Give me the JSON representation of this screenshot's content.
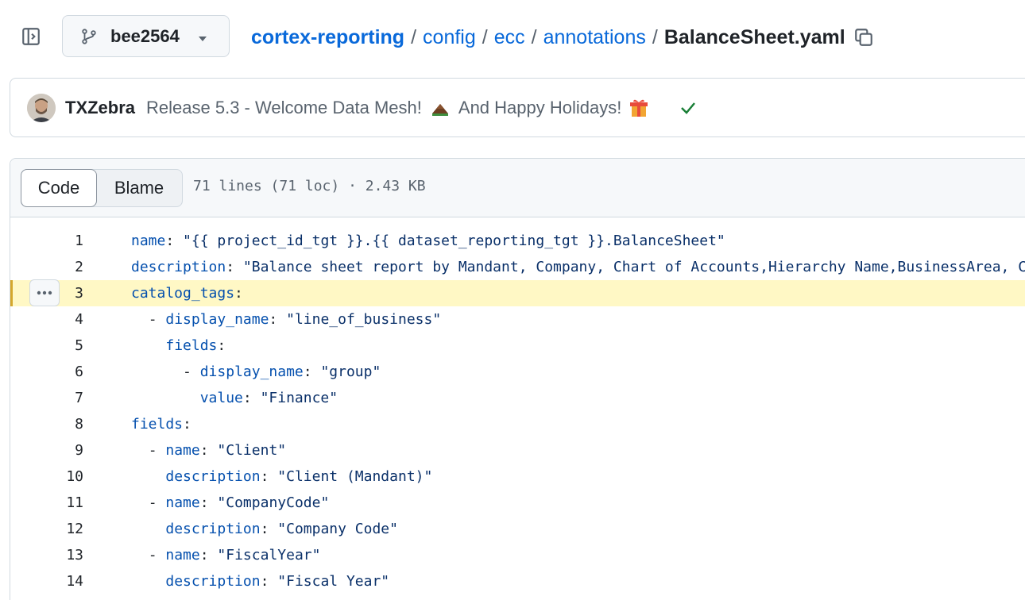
{
  "header": {
    "branch": "bee2564",
    "breadcrumb": {
      "repo": "cortex-reporting",
      "dirs": [
        "config",
        "ecc",
        "annotations"
      ],
      "file": "BalanceSheet.yaml",
      "separator": "/"
    }
  },
  "commit": {
    "author": "TXZebra",
    "message_part1": "Release 5.3 - Welcome Data Mesh!",
    "message_part2": "And Happy Holidays!",
    "status": "success"
  },
  "file": {
    "tabs": {
      "code": "Code",
      "blame": "Blame"
    },
    "meta": "71 lines (71 loc) · 2.43 KB",
    "highlighted_line": 3,
    "lines": [
      {
        "n": "1",
        "indent": "",
        "dash": "",
        "key": "name",
        "colon": ": ",
        "value": "\"{{ project_id_tgt }}.{{ dataset_reporting_tgt }}.BalanceSheet\""
      },
      {
        "n": "2",
        "indent": "",
        "dash": "",
        "key": "description",
        "colon": ": ",
        "value": "\"Balance sheet report by Mandant, Company, Chart of Accounts,Hierarchy Name,BusinessArea, C"
      },
      {
        "n": "3",
        "indent": "",
        "dash": "",
        "key": "catalog_tags",
        "colon": ":",
        "value": ""
      },
      {
        "n": "4",
        "indent": "  ",
        "dash": "- ",
        "key": "display_name",
        "colon": ": ",
        "value": "\"line_of_business\""
      },
      {
        "n": "5",
        "indent": "    ",
        "dash": "",
        "key": "fields",
        "colon": ":",
        "value": ""
      },
      {
        "n": "6",
        "indent": "      ",
        "dash": "- ",
        "key": "display_name",
        "colon": ": ",
        "value": "\"group\""
      },
      {
        "n": "7",
        "indent": "        ",
        "dash": "",
        "key": "value",
        "colon": ": ",
        "value": "\"Finance\""
      },
      {
        "n": "8",
        "indent": "",
        "dash": "",
        "key": "fields",
        "colon": ":",
        "value": ""
      },
      {
        "n": "9",
        "indent": "  ",
        "dash": "- ",
        "key": "name",
        "colon": ": ",
        "value": "\"Client\""
      },
      {
        "n": "10",
        "indent": "    ",
        "dash": "",
        "key": "description",
        "colon": ": ",
        "value": "\"Client (Mandant)\""
      },
      {
        "n": "11",
        "indent": "  ",
        "dash": "- ",
        "key": "name",
        "colon": ": ",
        "value": "\"CompanyCode\""
      },
      {
        "n": "12",
        "indent": "    ",
        "dash": "",
        "key": "description",
        "colon": ": ",
        "value": "\"Company Code\""
      },
      {
        "n": "13",
        "indent": "  ",
        "dash": "- ",
        "key": "name",
        "colon": ": ",
        "value": "\"FiscalYear\""
      },
      {
        "n": "14",
        "indent": "    ",
        "dash": "",
        "key": "description",
        "colon": ": ",
        "value": "\"Fiscal Year\""
      }
    ]
  },
  "icons": {
    "sidebar": "sidebar-expand-icon",
    "branch": "git-branch-icon",
    "caret": "triangle-down-icon",
    "copy": "copy-icon",
    "check": "check-icon",
    "more": "kebab-horizontal-icon"
  },
  "colors": {
    "link": "#0969da",
    "key": "#0550ae",
    "string": "#0a3069",
    "highlight": "#fff8c5",
    "check": "#1a7f37"
  }
}
